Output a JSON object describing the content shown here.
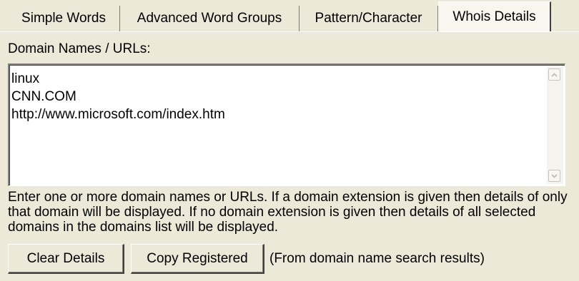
{
  "tabs": [
    {
      "label": "Simple Words",
      "selected": false
    },
    {
      "label": "Advanced Word Groups",
      "selected": false
    },
    {
      "label": "Pattern/Character",
      "selected": false
    },
    {
      "label": "Whois Details",
      "selected": true
    }
  ],
  "domains_label": "Domain Names / URLs:",
  "domains_text": [
    "linux",
    "CNN.COM",
    "http://www.microsoft.com/index.htm"
  ],
  "help_text": "Enter one or more domain names or URLs. If a domain extension is given then details of only that domain will be displayed. If no domain extension is given then details of all selected domains in the domains list will be displayed.",
  "buttons": {
    "clear_details": "Clear Details",
    "copy_registered": "Copy Registered"
  },
  "copy_note": "(From domain name search results)",
  "icons": {
    "scroll_up": "scroll-up-arrow-icon",
    "scroll_down": "scroll-down-arrow-icon"
  }
}
